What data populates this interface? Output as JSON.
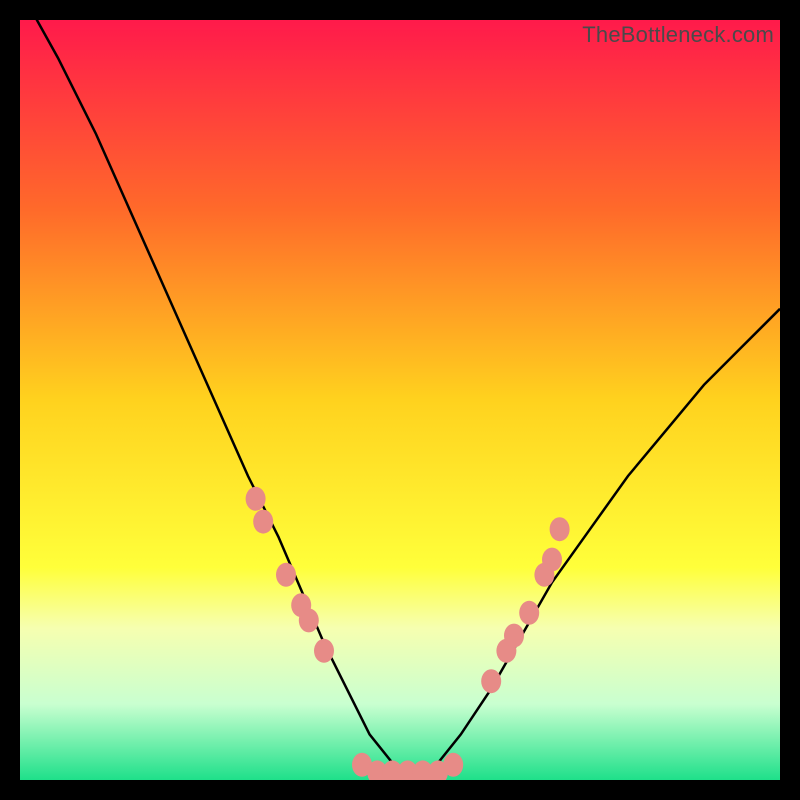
{
  "watermark": "TheBottleneck.com",
  "chart_data": {
    "type": "line",
    "title": "",
    "xlabel": "",
    "ylabel": "",
    "xlim": [
      0,
      100
    ],
    "ylim": [
      0,
      100
    ],
    "grid": false,
    "legend": false,
    "background_gradient_stops": [
      {
        "offset": 0,
        "color": "#ff1a4b"
      },
      {
        "offset": 25,
        "color": "#ff6a2a"
      },
      {
        "offset": 50,
        "color": "#ffd21e"
      },
      {
        "offset": 72,
        "color": "#ffff3a"
      },
      {
        "offset": 80,
        "color": "#f6ffb0"
      },
      {
        "offset": 90,
        "color": "#c9ffd0"
      },
      {
        "offset": 100,
        "color": "#1ee08a"
      }
    ],
    "series": [
      {
        "name": "bottleneck-curve",
        "x": [
          0,
          5,
          10,
          14,
          18,
          22,
          26,
          30,
          34,
          37,
          40,
          43,
          46,
          50,
          54,
          58,
          62,
          66,
          70,
          75,
          80,
          85,
          90,
          95,
          100
        ],
        "values": [
          104,
          95,
          85,
          76,
          67,
          58,
          49,
          40,
          32,
          25,
          18,
          12,
          6,
          1,
          1,
          6,
          12,
          19,
          26,
          33,
          40,
          46,
          52,
          57,
          62
        ]
      }
    ],
    "markers": {
      "name": "highlight-points",
      "color": "#e78b87",
      "points": [
        {
          "x": 31,
          "y": 37
        },
        {
          "x": 32,
          "y": 34
        },
        {
          "x": 35,
          "y": 27
        },
        {
          "x": 37,
          "y": 23
        },
        {
          "x": 38,
          "y": 21
        },
        {
          "x": 40,
          "y": 17
        },
        {
          "x": 45,
          "y": 2
        },
        {
          "x": 47,
          "y": 1
        },
        {
          "x": 49,
          "y": 1
        },
        {
          "x": 51,
          "y": 1
        },
        {
          "x": 53,
          "y": 1
        },
        {
          "x": 55,
          "y": 1
        },
        {
          "x": 57,
          "y": 2
        },
        {
          "x": 62,
          "y": 13
        },
        {
          "x": 64,
          "y": 17
        },
        {
          "x": 65,
          "y": 19
        },
        {
          "x": 67,
          "y": 22
        },
        {
          "x": 69,
          "y": 27
        },
        {
          "x": 70,
          "y": 29
        },
        {
          "x": 71,
          "y": 33
        }
      ]
    }
  }
}
